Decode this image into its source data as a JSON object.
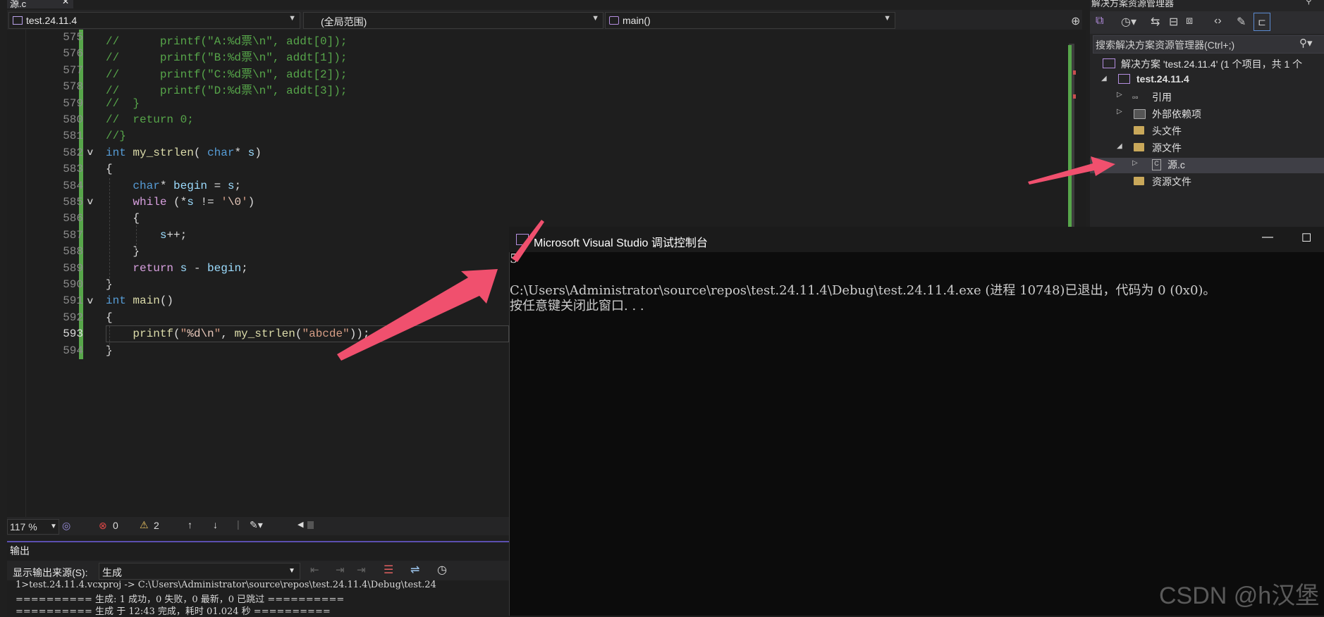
{
  "tab": {
    "label": "源.c",
    "close": "✕"
  },
  "nav": {
    "project": "test.24.11.4",
    "scope": "(全局范围)",
    "member": "main()"
  },
  "editor": {
    "lines": [
      {
        "n": "575",
        "tokens": [
          {
            "t": "//      printf(\"A:%d票\\n\", addt[0]);",
            "c": "cm"
          }
        ]
      },
      {
        "n": "576",
        "tokens": [
          {
            "t": "//      printf(\"B:%d票\\n\", addt[1]);",
            "c": "cm"
          }
        ]
      },
      {
        "n": "577",
        "tokens": [
          {
            "t": "//      printf(\"C:%d票\\n\", addt[2]);",
            "c": "cm"
          }
        ]
      },
      {
        "n": "578",
        "tokens": [
          {
            "t": "//      printf(\"D:%d票\\n\", addt[3]);",
            "c": "cm"
          }
        ]
      },
      {
        "n": "579",
        "tokens": [
          {
            "t": "//  }",
            "c": "cm"
          }
        ]
      },
      {
        "n": "580",
        "tokens": [
          {
            "t": "//  return 0;",
            "c": "cm"
          }
        ]
      },
      {
        "n": "581",
        "tokens": [
          {
            "t": "//}",
            "c": "cm"
          }
        ]
      },
      {
        "n": "582",
        "tokens": [
          {
            "t": "int",
            "c": "kw"
          },
          {
            "t": " ",
            "c": ""
          },
          {
            "t": "my_strlen",
            "c": "fn"
          },
          {
            "t": "( ",
            "c": ""
          },
          {
            "t": "char",
            "c": "kw"
          },
          {
            "t": "* ",
            "c": ""
          },
          {
            "t": "s",
            "c": "var"
          },
          {
            "t": ")",
            "c": ""
          }
        ]
      },
      {
        "n": "583",
        "tokens": [
          {
            "t": "{",
            "c": ""
          }
        ]
      },
      {
        "n": "584",
        "tokens": [
          {
            "t": "    ",
            "c": ""
          },
          {
            "t": "char",
            "c": "kw"
          },
          {
            "t": "* ",
            "c": ""
          },
          {
            "t": "begin",
            "c": "var"
          },
          {
            "t": " = ",
            "c": ""
          },
          {
            "t": "s",
            "c": "var"
          },
          {
            "t": ";",
            "c": ""
          }
        ]
      },
      {
        "n": "585",
        "tokens": [
          {
            "t": "    ",
            "c": ""
          },
          {
            "t": "while",
            "c": "ctl"
          },
          {
            "t": " (*",
            "c": ""
          },
          {
            "t": "s",
            "c": "var"
          },
          {
            "t": " != ",
            "c": ""
          },
          {
            "t": "'",
            "c": "str"
          },
          {
            "t": "\\0",
            "c": "esc"
          },
          {
            "t": "'",
            "c": "str"
          },
          {
            "t": ")",
            "c": ""
          }
        ]
      },
      {
        "n": "586",
        "tokens": [
          {
            "t": "    {",
            "c": ""
          }
        ]
      },
      {
        "n": "587",
        "tokens": [
          {
            "t": "        ",
            "c": ""
          },
          {
            "t": "s",
            "c": "var"
          },
          {
            "t": "++;",
            "c": ""
          }
        ]
      },
      {
        "n": "588",
        "tokens": [
          {
            "t": "    }",
            "c": ""
          }
        ]
      },
      {
        "n": "589",
        "tokens": [
          {
            "t": "    ",
            "c": ""
          },
          {
            "t": "return",
            "c": "ctl"
          },
          {
            "t": " ",
            "c": ""
          },
          {
            "t": "s",
            "c": "var"
          },
          {
            "t": " - ",
            "c": ""
          },
          {
            "t": "begin",
            "c": "var"
          },
          {
            "t": ";",
            "c": ""
          }
        ]
      },
      {
        "n": "590",
        "tokens": [
          {
            "t": "}",
            "c": ""
          }
        ]
      },
      {
        "n": "591",
        "tokens": [
          {
            "t": "int",
            "c": "kw"
          },
          {
            "t": " ",
            "c": ""
          },
          {
            "t": "main",
            "c": "fn"
          },
          {
            "t": "()",
            "c": ""
          }
        ]
      },
      {
        "n": "592",
        "tokens": [
          {
            "t": "{",
            "c": ""
          }
        ]
      },
      {
        "n": "593",
        "tokens": [
          {
            "t": "    ",
            "c": ""
          },
          {
            "t": "printf",
            "c": "fn"
          },
          {
            "t": "(",
            "c": ""
          },
          {
            "t": "\"",
            "c": "str"
          },
          {
            "t": "%d",
            "c": "esc"
          },
          {
            "t": "\\n",
            "c": "esc"
          },
          {
            "t": "\"",
            "c": "str"
          },
          {
            "t": ", ",
            "c": ""
          },
          {
            "t": "my_strlen",
            "c": "fn"
          },
          {
            "t": "(",
            "c": ""
          },
          {
            "t": "\"abcde\"",
            "c": "str"
          },
          {
            "t": "));",
            "c": ""
          }
        ]
      },
      {
        "n": "594",
        "tokens": [
          {
            "t": "}",
            "c": ""
          }
        ]
      }
    ],
    "current_line": "593"
  },
  "status": {
    "zoom": "117 %",
    "errors": "0",
    "warnings": "2"
  },
  "output": {
    "title": "输出",
    "source_label": "显示输出来源(S):",
    "source_value": "生成",
    "lines": [
      "1>test.24.11.4.vcxproj -> C:\\Users\\Administrator\\source\\repos\\test.24.11.4\\Debug\\test.24",
      "========== 生成: 1 成功，0 失败，0 最新，0 已跳过 ==========",
      "========== 生成 于 12:43 完成，耗时 01.024 秒 =========="
    ]
  },
  "solution_explorer": {
    "title": "解决方案资源管理器",
    "search_placeholder": "搜索解决方案资源管理器(Ctrl+;)",
    "solution": "解决方案 'test.24.11.4' (1 个项目，共 1 个",
    "project": "test.24.11.4",
    "nodes": {
      "references": "引用",
      "external": "外部依赖项",
      "headers": "头文件",
      "sources": "源文件",
      "source_file": "源.c",
      "resources": "资源文件"
    }
  },
  "console": {
    "title": "Microsoft Visual Studio 调试控制台",
    "lines": [
      "5",
      "",
      "C:\\Users\\Administrator\\source\\repos\\test.24.11.4\\Debug\\test.24.11.4.exe (进程 10748)已退出，代码为 0 (0x0)。",
      "按任意键关闭此窗口. . ."
    ],
    "minimize": "—",
    "maximize": "☐"
  },
  "watermark": "CSDN @h汉堡",
  "colors": {
    "accent": "#685cc3",
    "annotation_arrow": "#f0506e",
    "change_bar": "#57a64a"
  }
}
